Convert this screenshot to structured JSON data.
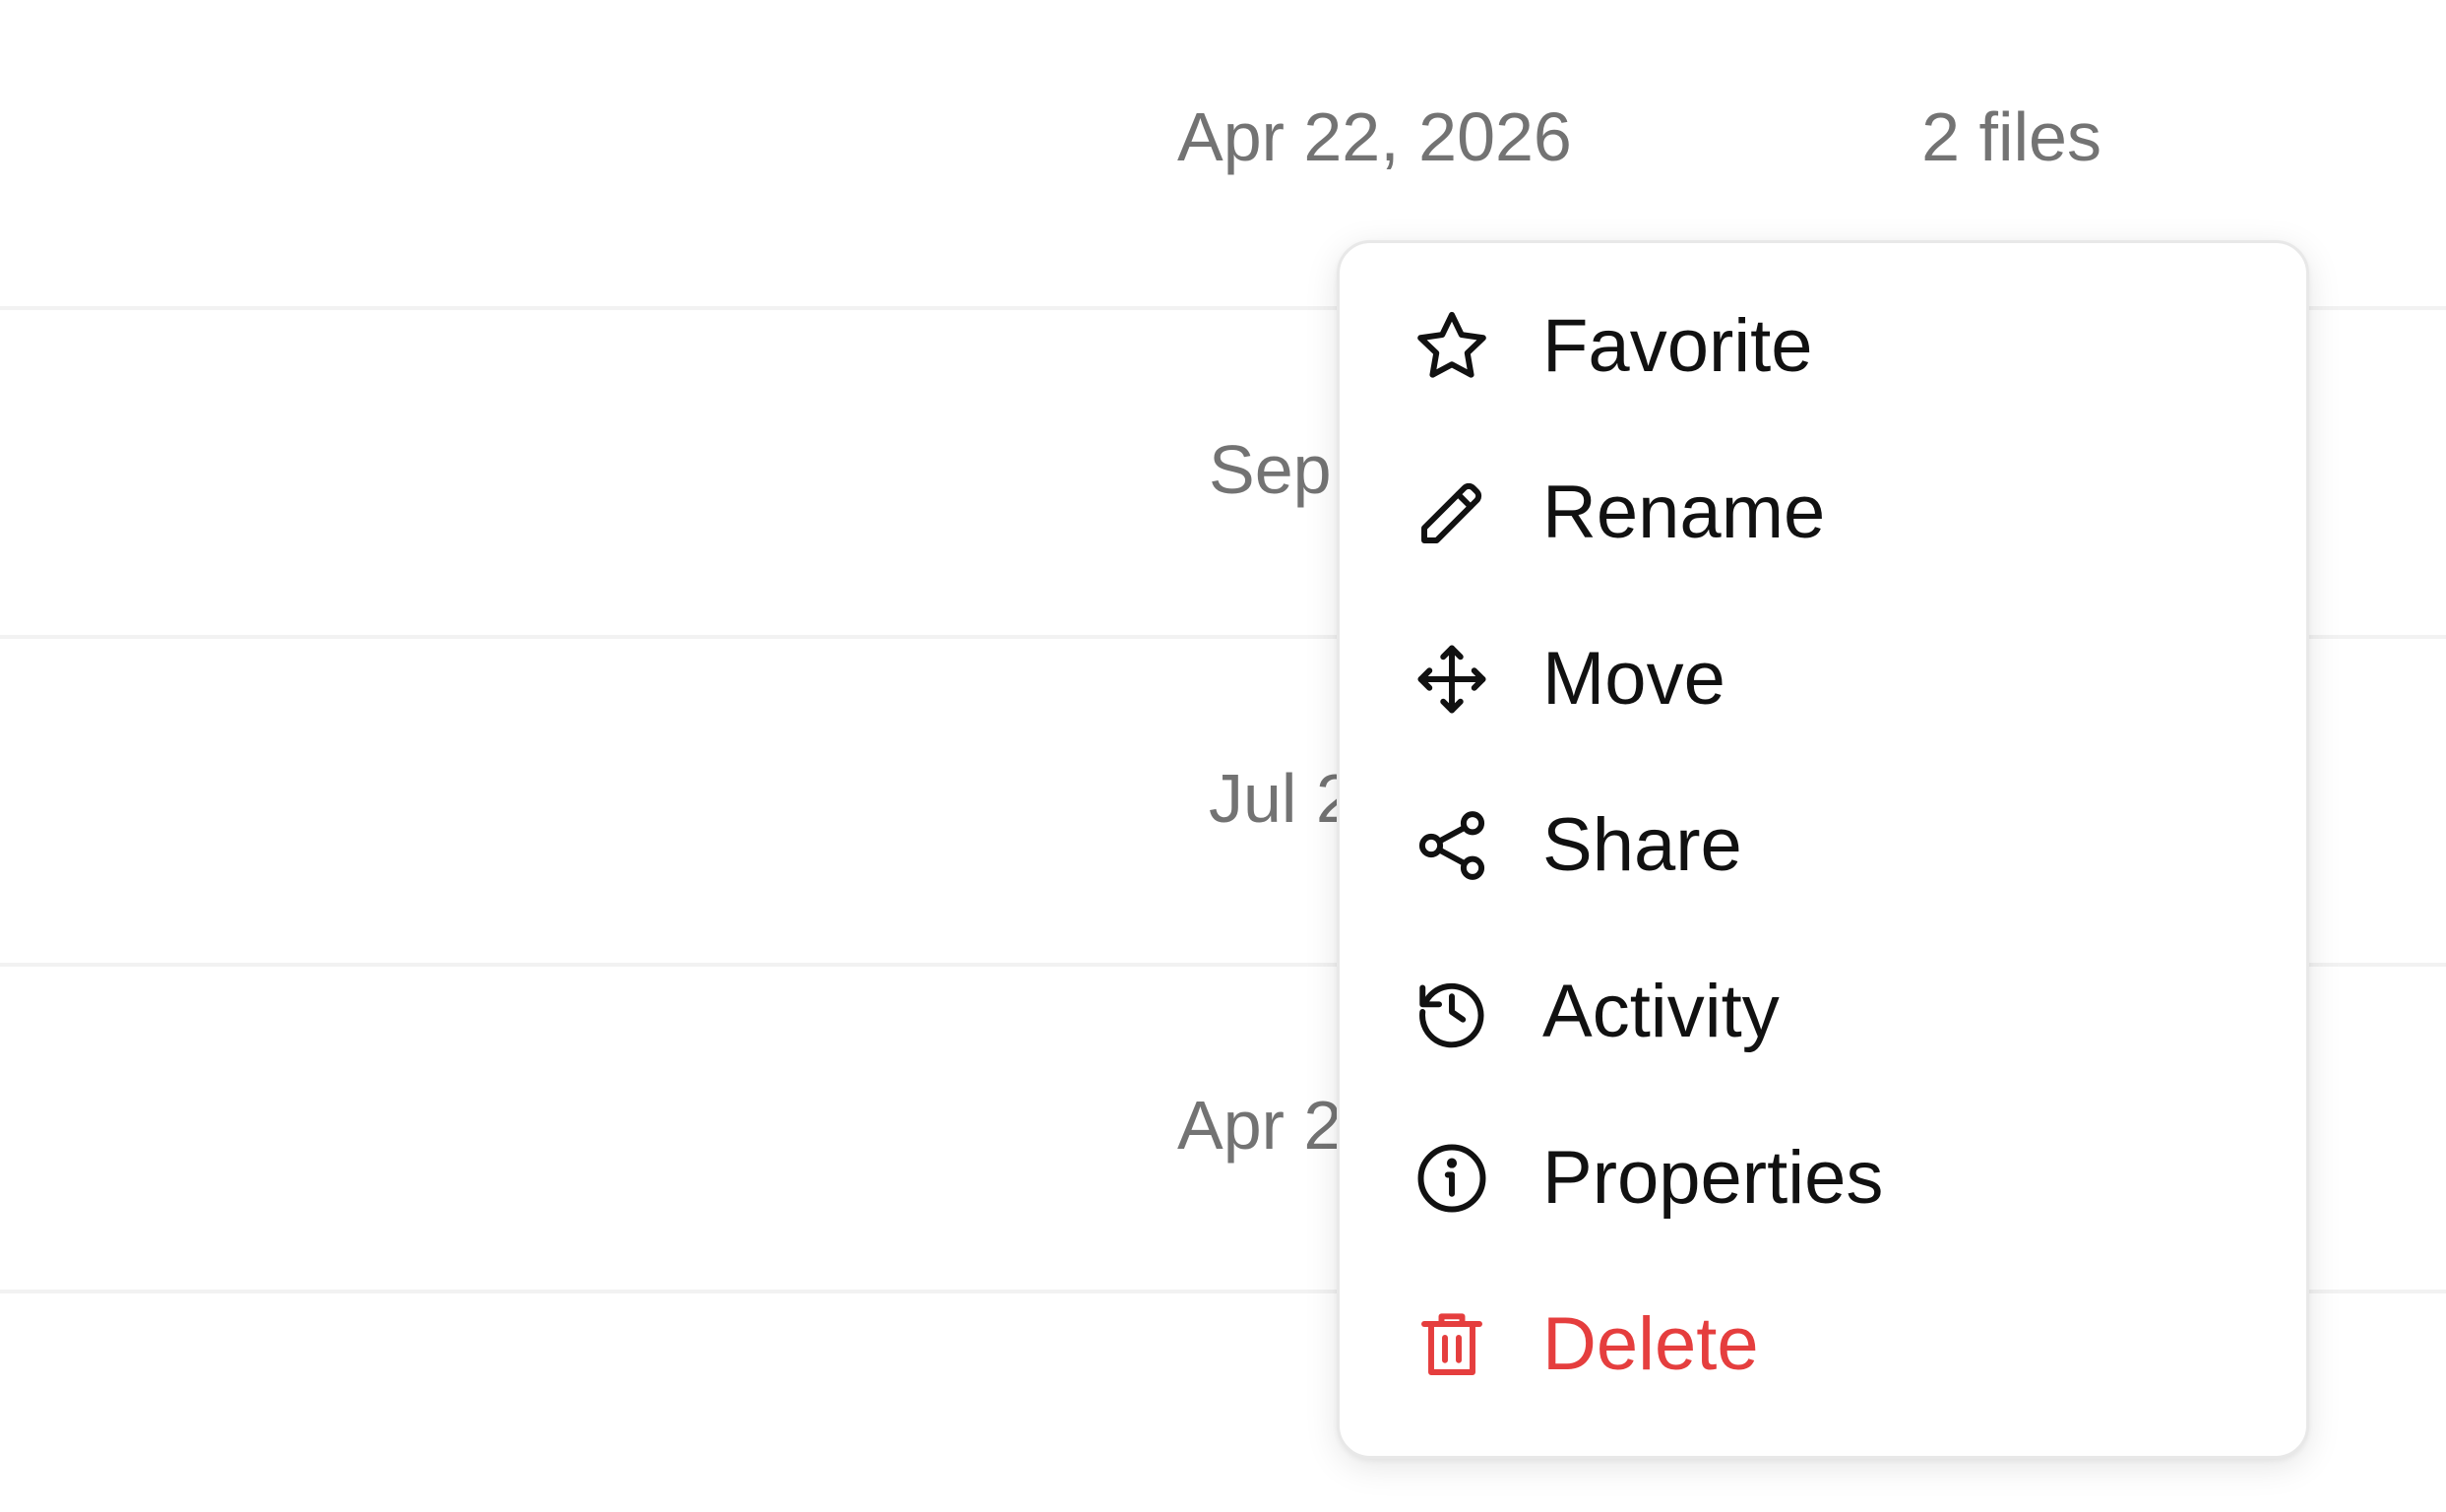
{
  "rows": [
    {
      "date": "Apr 22, 2026",
      "count": "2 files"
    },
    {
      "date": "Sep",
      "count": ""
    },
    {
      "date": "Jul 2",
      "count": ""
    },
    {
      "date": "Apr 2",
      "count": ""
    }
  ],
  "context_menu": {
    "items": [
      {
        "label": "Favorite",
        "icon": "star-icon"
      },
      {
        "label": "Rename",
        "icon": "pencil-icon"
      },
      {
        "label": "Move",
        "icon": "move-arrows-icon"
      },
      {
        "label": "Share",
        "icon": "share-icon"
      },
      {
        "label": "Activity",
        "icon": "history-icon"
      },
      {
        "label": "Properties",
        "icon": "info-icon"
      },
      {
        "label": "Delete",
        "icon": "trash-icon",
        "danger": true
      }
    ]
  },
  "colors": {
    "text_muted": "#737373",
    "text_primary": "#111111",
    "danger": "#e53e3e",
    "divider": "#f2f2f2"
  }
}
